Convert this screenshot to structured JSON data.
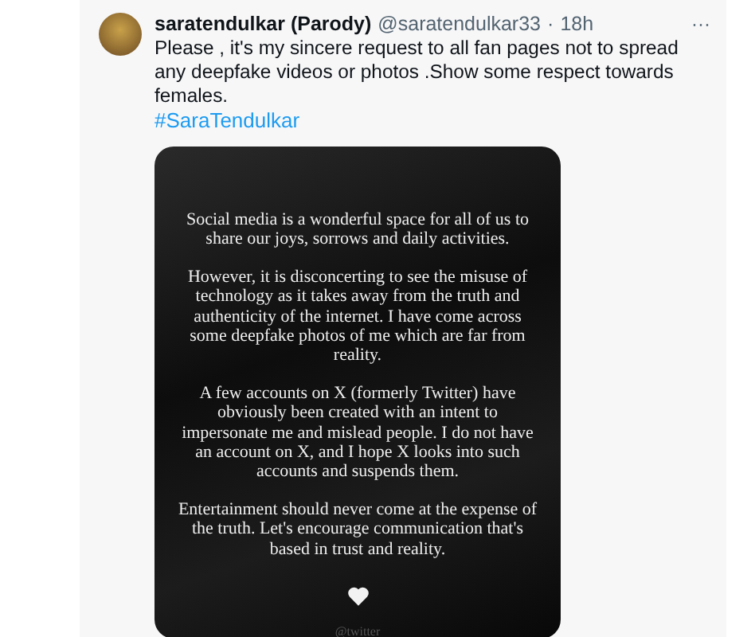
{
  "tweet": {
    "display_name": "saratendulkar (Parody)",
    "handle": "@saratendulkar33",
    "separator": "·",
    "time": "18h",
    "more": "···",
    "text": "Please , it's my sincere request to all fan pages not to spread any deepfake videos or photos .Show some respect towards females.",
    "hashtag": "#SaraTendulkar",
    "media": {
      "paragraphs": [
        "Social media is a wonderful space for all of us to share our joys, sorrows and daily activities.",
        "However, it is disconcerting to see the misuse of technology as it takes away from the truth and authenticity of the internet. I have come across some deepfake photos of me which are far from reality.",
        "A few accounts on X (formerly Twitter) have obviously been created with an intent to impersonate me and mislead people. I do not have an account on X, and I hope X looks into such accounts and suspends them.",
        "Entertainment should never come at the expense of the truth. Let's encourage communication that's based in trust and reality."
      ],
      "footer": "@twitter"
    }
  }
}
